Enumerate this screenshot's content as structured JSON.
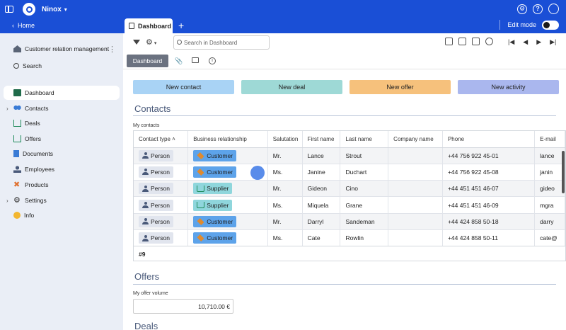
{
  "topbar": {
    "app_name": "Ninox"
  },
  "subbar": {
    "home_label": "Home",
    "tab_label": "Dashboard",
    "edit_mode_label": "Edit mode"
  },
  "sidebar": {
    "items": [
      {
        "label": "Customer relation management",
        "icon": "house-icon"
      },
      {
        "label": "Search",
        "icon": "search-icon"
      },
      {
        "label": "Dashboard",
        "icon": "dashboard-icon",
        "active": true
      },
      {
        "label": "Contacts",
        "icon": "contacts-icon",
        "expandable": true
      },
      {
        "label": "Deals",
        "icon": "cart-icon"
      },
      {
        "label": "Offers",
        "icon": "cart-icon"
      },
      {
        "label": "Documents",
        "icon": "document-icon"
      },
      {
        "label": "Employees",
        "icon": "person-icon"
      },
      {
        "label": "Products",
        "icon": "tools-icon"
      },
      {
        "label": "Settings",
        "icon": "gear-icon",
        "expandable": true
      },
      {
        "label": "Info",
        "icon": "info-icon"
      }
    ]
  },
  "toolbar": {
    "search_placeholder": "Search in Dashboard"
  },
  "subtabs": {
    "active_label": "Dashboard"
  },
  "actions": [
    {
      "label": "New contact",
      "color": "#a9d3f5"
    },
    {
      "label": "New deal",
      "color": "#9ed9d6"
    },
    {
      "label": "New offer",
      "color": "#f6c17c"
    },
    {
      "label": "New activity",
      "color": "#aab7ee"
    }
  ],
  "contacts": {
    "title": "Contacts",
    "field_label": "My contacts",
    "columns": [
      "Contact type",
      "Business relationship",
      "Salutation",
      "First name",
      "Last name",
      "Company name",
      "Phone",
      "E-mail"
    ],
    "rows": [
      {
        "type": "Person",
        "relation": "Customer",
        "salutation": "Mr.",
        "first": "Lance",
        "last": "Strout",
        "company": "",
        "phone": "+44 756 922 45-01",
        "email": "lance"
      },
      {
        "type": "Person",
        "relation": "Customer",
        "salutation": "Ms.",
        "first": "Janine",
        "last": "Duchart",
        "company": "",
        "phone": "+44 756 922 45-08",
        "email": "janin"
      },
      {
        "type": "Person",
        "relation": "Supplier",
        "salutation": "Mr.",
        "first": "Gideon",
        "last": "Cino",
        "company": "",
        "phone": "+44 451 451 46-07",
        "email": "gideo"
      },
      {
        "type": "Person",
        "relation": "Supplier",
        "salutation": "Ms.",
        "first": "Miquela",
        "last": "Grane",
        "company": "",
        "phone": "+44 451 451 46-09",
        "email": "mgra"
      },
      {
        "type": "Person",
        "relation": "Customer",
        "salutation": "Mr.",
        "first": "Darryl",
        "last": "Sandeman",
        "company": "",
        "phone": "+44 424 858 50-18",
        "email": "darry"
      },
      {
        "type": "Person",
        "relation": "Customer",
        "salutation": "Ms.",
        "first": "Cate",
        "last": "Rowlin",
        "company": "",
        "phone": "+44 424 858 50-11",
        "email": "cate@"
      }
    ],
    "footer": "#9"
  },
  "offers": {
    "title": "Offers",
    "field_label": "My offer volume",
    "value": "10,710.00 €"
  },
  "deals": {
    "title": "Deals"
  }
}
